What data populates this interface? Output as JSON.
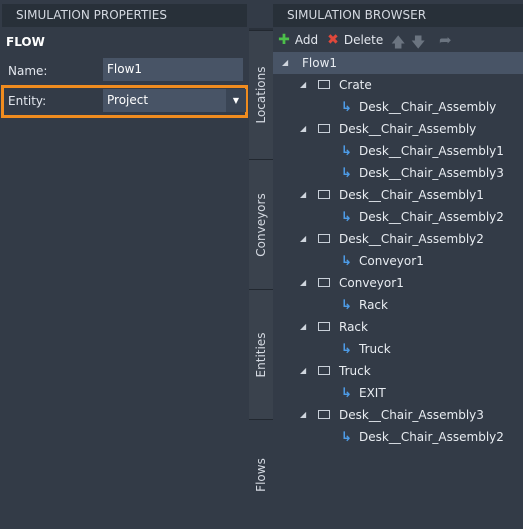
{
  "left_panel": {
    "header": "SIMULATION PROPERTIES",
    "section_title": "FLOW",
    "name_label": "Name:",
    "name_value": "Flow1",
    "entity_label": "Entity:",
    "entity_value": "Project",
    "highlight_color": "#f08c1f"
  },
  "tabs": [
    "Locations",
    "Conveyors",
    "Entities",
    "Flows"
  ],
  "right_panel": {
    "header": "SIMULATION BROWSER",
    "toolbar": {
      "add_label": "Add",
      "delete_label": "Delete",
      "icons": [
        "plus-icon",
        "x-icon",
        "arrow-up-icon",
        "arrow-down-icon",
        "redo-icon"
      ]
    },
    "tree": {
      "root": "Flow1",
      "nodes": [
        {
          "label": "Crate",
          "children": [
            "Desk__Chair_Assembly"
          ]
        },
        {
          "label": "Desk__Chair_Assembly",
          "children": [
            "Desk__Chair_Assembly1",
            "Desk__Chair_Assembly3"
          ]
        },
        {
          "label": "Desk__Chair_Assembly1",
          "children": [
            "Desk__Chair_Assembly2"
          ]
        },
        {
          "label": "Desk__Chair_Assembly2",
          "children": [
            "Conveyor1"
          ]
        },
        {
          "label": "Conveyor1",
          "children": [
            "Rack"
          ]
        },
        {
          "label": "Rack",
          "children": [
            "Truck"
          ]
        },
        {
          "label": "Truck",
          "children": [
            "EXIT"
          ]
        },
        {
          "label": "Desk__Chair_Assembly3",
          "children": [
            "Desk__Chair_Assembly2"
          ]
        }
      ]
    }
  }
}
